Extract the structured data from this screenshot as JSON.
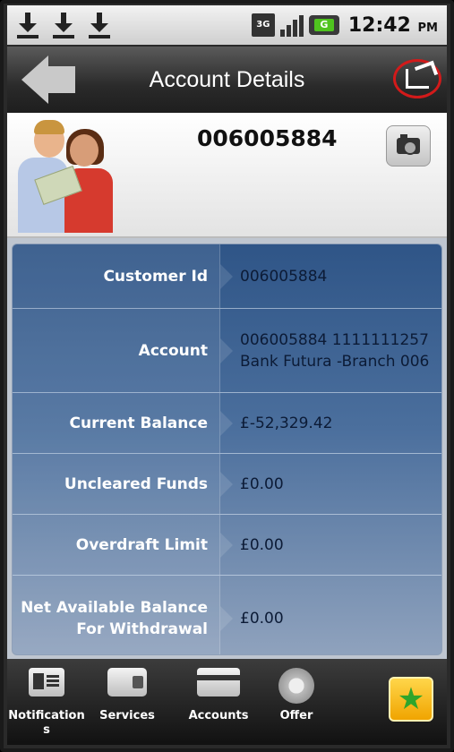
{
  "status_bar": {
    "network": "3G",
    "battery_label": "G",
    "time": "12:42",
    "ampm": "PM"
  },
  "header": {
    "title": "Account Details"
  },
  "profile": {
    "account_number": "006005884"
  },
  "details": [
    {
      "label": "Customer Id",
      "value": "006005884"
    },
    {
      "label": "Account",
      "value": "006005884 1111111257 Bank Futura -Branch 006"
    },
    {
      "label": "Current Balance",
      "value": "£-52,329.42"
    },
    {
      "label": "Uncleared Funds",
      "value": "£0.00"
    },
    {
      "label": "Overdraft Limit",
      "value": "£0.00"
    },
    {
      "label": "Net Available Balance For Withdrawal",
      "value": "£0.00"
    }
  ],
  "tabs": [
    {
      "label": "Notifications",
      "icon": "id-card-icon"
    },
    {
      "label": "Services",
      "icon": "wallet-icon"
    },
    {
      "label": "Accounts",
      "icon": "credit-card-icon"
    },
    {
      "label": "Offer",
      "icon": "gear-icon"
    }
  ],
  "colors": {
    "panel_top": "#2f5587",
    "panel_bottom": "#8fa2bd",
    "share_highlight": "#d21a1a",
    "favorite": "#f0a400"
  }
}
